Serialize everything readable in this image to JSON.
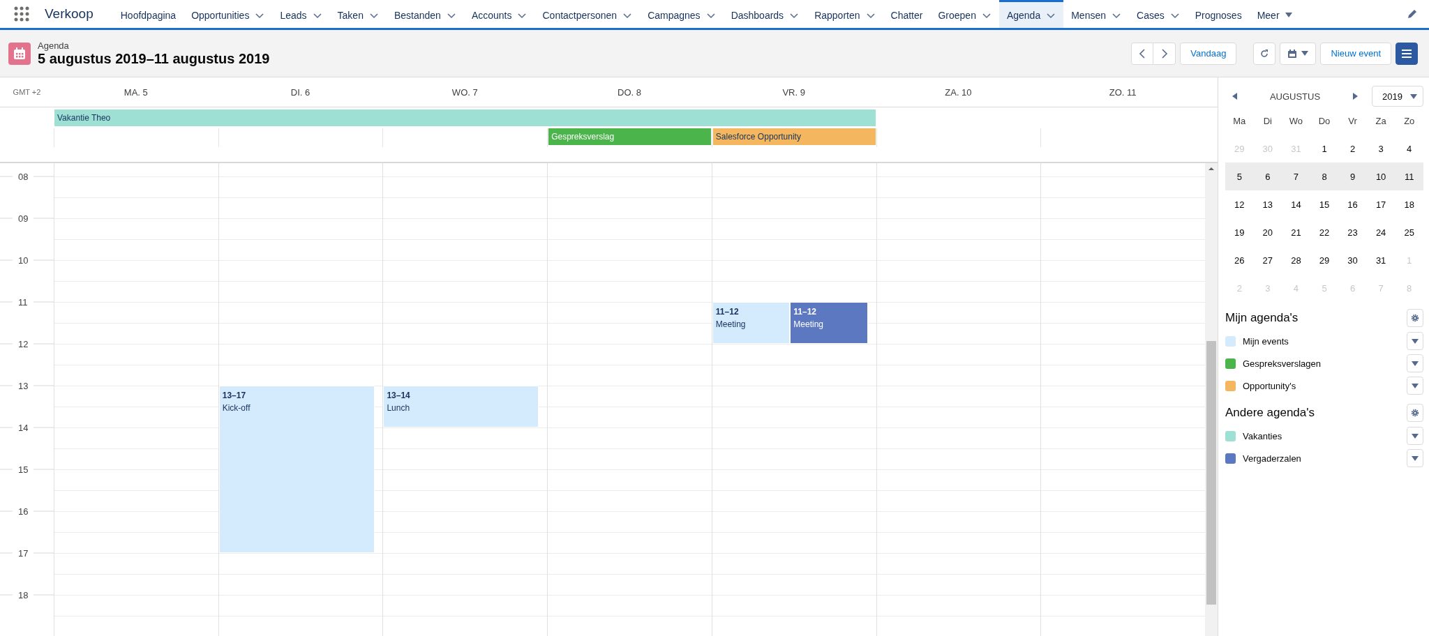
{
  "app_name": "Verkoop",
  "nav": [
    {
      "label": "Hoofdpagina",
      "kind": "tab",
      "dropdown": false,
      "selected": false
    },
    {
      "label": "Opportunities",
      "kind": "tab",
      "dropdown": true,
      "selected": false
    },
    {
      "label": "Leads",
      "kind": "tab",
      "dropdown": true,
      "selected": false
    },
    {
      "label": "Taken",
      "kind": "tab",
      "dropdown": true,
      "selected": false
    },
    {
      "label": "Bestanden",
      "kind": "tab",
      "dropdown": true,
      "selected": false
    },
    {
      "label": "Accounts",
      "kind": "tab",
      "dropdown": true,
      "selected": false
    },
    {
      "label": "Contactpersonen",
      "kind": "tab",
      "dropdown": true,
      "selected": false
    },
    {
      "label": "Campagnes",
      "kind": "tab",
      "dropdown": true,
      "selected": false
    },
    {
      "label": "Dashboards",
      "kind": "tab",
      "dropdown": true,
      "selected": false
    },
    {
      "label": "Rapporten",
      "kind": "tab",
      "dropdown": true,
      "selected": false
    },
    {
      "label": "Chatter",
      "kind": "tab",
      "dropdown": false,
      "selected": false
    },
    {
      "label": "Groepen",
      "kind": "tab",
      "dropdown": true,
      "selected": false
    },
    {
      "label": "Agenda",
      "kind": "tab",
      "dropdown": true,
      "selected": true
    },
    {
      "label": "Mensen",
      "kind": "tab",
      "dropdown": true,
      "selected": false
    },
    {
      "label": "Cases",
      "kind": "tab",
      "dropdown": true,
      "selected": false
    },
    {
      "label": "Prognoses",
      "kind": "tab",
      "dropdown": false,
      "selected": false
    },
    {
      "label": "Meer",
      "kind": "more",
      "dropdown": true,
      "selected": false
    }
  ],
  "header": {
    "object": "Agenda",
    "title": "5 augustus 2019–11 augustus 2019",
    "today_button": "Vandaag",
    "new_button": "Nieuw event"
  },
  "timezone": "GMT +2",
  "days": [
    {
      "label": "MA. 5"
    },
    {
      "label": "DI. 6",
      "events": [
        {
          "time": "13–17",
          "title": "Kick-off",
          "color": "#d4eafd"
        }
      ]
    },
    {
      "label": "WO. 7",
      "events": [
        {
          "time": "13–14",
          "title": "Lunch",
          "color": "#d4eafd"
        }
      ]
    },
    {
      "label": "DO. 8"
    },
    {
      "label": "VR. 9",
      "events": [
        {
          "time": "11–12",
          "title": "Meeting",
          "color": "#d4eafd"
        },
        {
          "time": "11–12",
          "title": "Meeting",
          "color": "#5b78c1"
        }
      ]
    },
    {
      "label": "ZA. 10"
    },
    {
      "label": "ZO. 11"
    }
  ],
  "all_day": [
    [
      {
        "kind": "event",
        "title": "Vakantie Theo",
        "color": "#9fe0d4"
      },
      {
        "kind": "continued"
      },
      {
        "kind": "continued"
      },
      {
        "kind": "continued"
      },
      {
        "kind": "continued"
      },
      {
        "kind": "empty"
      },
      {
        "kind": "empty"
      }
    ],
    [
      {
        "kind": "empty"
      },
      {
        "kind": "empty"
      },
      {
        "kind": "empty"
      },
      {
        "kind": "event",
        "title": "Gespreksverslag",
        "color": "#4bb54b"
      },
      {
        "kind": "event",
        "title": "Salesforce Opportunity",
        "color": "#f4b760"
      },
      {
        "kind": "empty"
      },
      {
        "kind": "empty"
      }
    ]
  ],
  "hours": [
    "08",
    "09",
    "10",
    "11",
    "12",
    "13",
    "14",
    "15",
    "16",
    "17",
    "18"
  ],
  "mini_calendar": {
    "month": "AUGUSTUS",
    "year": "2019",
    "weekdays": [
      "Ma",
      "Di",
      "Wo",
      "Do",
      "Vr",
      "Za",
      "Zo"
    ],
    "weeks": [
      {
        "selected": false,
        "days": [
          {
            "label": "29",
            "muted": true
          },
          {
            "label": "30",
            "muted": true
          },
          {
            "label": "31",
            "muted": true
          },
          {
            "label": "1",
            "muted": false
          },
          {
            "label": "2",
            "muted": false
          },
          {
            "label": "3",
            "muted": false
          },
          {
            "label": "4",
            "muted": false
          }
        ]
      },
      {
        "selected": true,
        "days": [
          {
            "label": "5",
            "muted": false
          },
          {
            "label": "6",
            "muted": false
          },
          {
            "label": "7",
            "muted": false
          },
          {
            "label": "8",
            "muted": false
          },
          {
            "label": "9",
            "muted": false
          },
          {
            "label": "10",
            "muted": false
          },
          {
            "label": "11",
            "muted": false
          }
        ]
      },
      {
        "selected": false,
        "days": [
          {
            "label": "12",
            "muted": false
          },
          {
            "label": "13",
            "muted": false
          },
          {
            "label": "14",
            "muted": false
          },
          {
            "label": "15",
            "muted": false
          },
          {
            "label": "16",
            "muted": false
          },
          {
            "label": "17",
            "muted": false
          },
          {
            "label": "18",
            "muted": false
          }
        ]
      },
      {
        "selected": false,
        "days": [
          {
            "label": "19",
            "muted": false
          },
          {
            "label": "20",
            "muted": false
          },
          {
            "label": "21",
            "muted": false
          },
          {
            "label": "22",
            "muted": false
          },
          {
            "label": "23",
            "muted": false
          },
          {
            "label": "24",
            "muted": false
          },
          {
            "label": "25",
            "muted": false
          }
        ]
      },
      {
        "selected": false,
        "days": [
          {
            "label": "26",
            "muted": false
          },
          {
            "label": "27",
            "muted": false
          },
          {
            "label": "28",
            "muted": false
          },
          {
            "label": "29",
            "muted": false
          },
          {
            "label": "30",
            "muted": false
          },
          {
            "label": "31",
            "muted": false
          },
          {
            "label": "1",
            "muted": true
          }
        ]
      },
      {
        "selected": false,
        "days": [
          {
            "label": "2",
            "muted": true
          },
          {
            "label": "3",
            "muted": true
          },
          {
            "label": "4",
            "muted": true
          },
          {
            "label": "5",
            "muted": true
          },
          {
            "label": "6",
            "muted": true
          },
          {
            "label": "7",
            "muted": true
          },
          {
            "label": "8",
            "muted": true
          }
        ]
      }
    ]
  },
  "calendar_groups": [
    {
      "title": "Mijn agenda's",
      "items": [
        {
          "label": "Mijn events",
          "color": "#d4eafd"
        },
        {
          "label": "Gespreksverslagen",
          "color": "#4bb54b"
        },
        {
          "label": "Opportunity's",
          "color": "#f4b760"
        }
      ]
    },
    {
      "title": "Andere agenda's",
      "items": [
        {
          "label": "Vakanties",
          "color": "#9fe0d4"
        },
        {
          "label": "Vergaderzalen",
          "color": "#5b78c1"
        }
      ]
    }
  ]
}
